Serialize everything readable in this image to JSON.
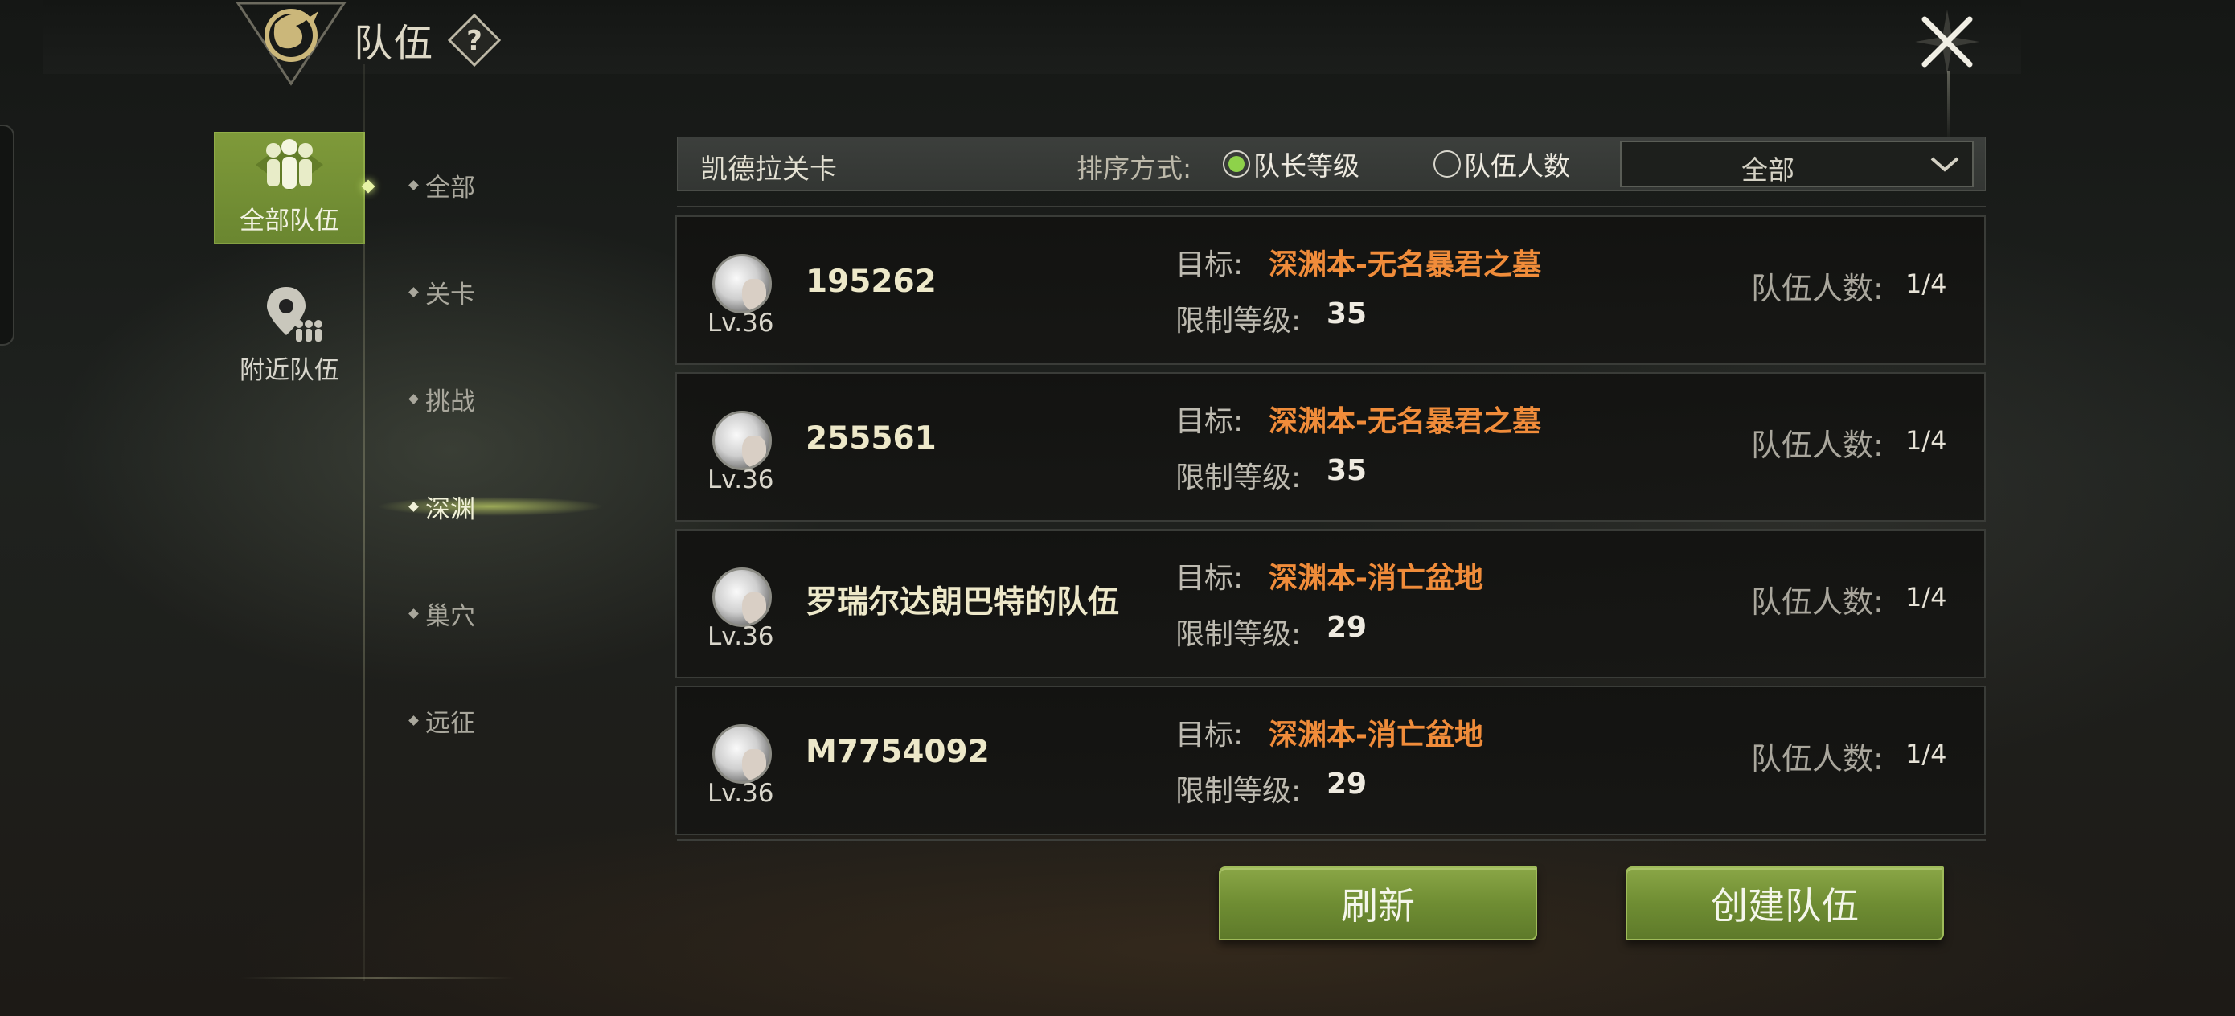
{
  "header": {
    "title": "队伍",
    "help_label": "?"
  },
  "sidebar": {
    "tabs": [
      {
        "label": "全部队伍",
        "icon": "group-icon",
        "active": true
      },
      {
        "label": "附近队伍",
        "icon": "location-group-icon",
        "active": false
      }
    ],
    "categories": [
      {
        "label": "全部",
        "active": false
      },
      {
        "label": "关卡",
        "active": false
      },
      {
        "label": "挑战",
        "active": false
      },
      {
        "label": "深渊",
        "active": true
      },
      {
        "label": "巢穴",
        "active": false
      },
      {
        "label": "远征",
        "active": false
      }
    ]
  },
  "filter": {
    "stage_label": "凯德拉关卡",
    "sort_label": "排序方式:",
    "sort_options": [
      {
        "label": "队长等级",
        "checked": true
      },
      {
        "label": "队伍人数",
        "checked": false
      }
    ],
    "dropdown_value": "全部"
  },
  "team_fields": {
    "target_label": "目标:",
    "level_limit_label": "限制等级:",
    "count_label": "队伍人数:"
  },
  "teams": [
    {
      "name": "195262",
      "level": "Lv.36",
      "target": "深渊本-无名暴君之墓",
      "level_limit": "35",
      "count": "1/4"
    },
    {
      "name": "255561",
      "level": "Lv.36",
      "target": "深渊本-无名暴君之墓",
      "level_limit": "35",
      "count": "1/4"
    },
    {
      "name": "罗瑞尔达朗巴特的队伍",
      "level": "Lv.36",
      "target": "深渊本-消亡盆地",
      "level_limit": "29",
      "count": "1/4"
    },
    {
      "name": "M7754092",
      "level": "Lv.36",
      "target": "深渊本-消亡盆地",
      "level_limit": "29",
      "count": "1/4"
    }
  ],
  "actions": {
    "refresh_label": "刷新",
    "create_label": "创建队伍"
  },
  "colors": {
    "accent_green": "#7f9a3a",
    "target_orange": "#f08c3a",
    "radio_green": "#8ed24a"
  }
}
